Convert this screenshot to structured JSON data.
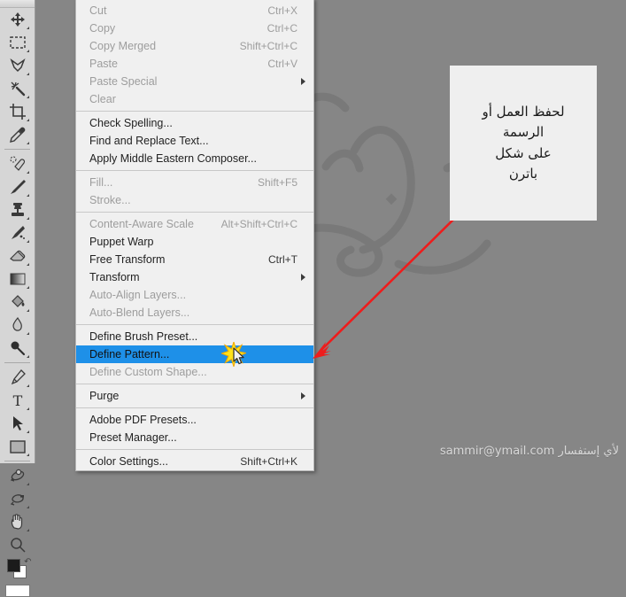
{
  "app": {
    "name": "Adobe Photoshop",
    "background_color": "#868686",
    "accent_color": "#1e90e8",
    "arrow_color": "#ee1c1c"
  },
  "toolbar": {
    "name": "tools-panel",
    "tools": [
      {
        "id": "move-tool",
        "label": "Move Tool"
      },
      {
        "id": "rectangular-marquee-tool",
        "label": "Rectangular Marquee Tool"
      },
      {
        "id": "lasso-tool",
        "label": "Lasso Tool"
      },
      {
        "id": "quick-selection-tool",
        "label": "Quick Selection Tool"
      },
      {
        "id": "crop-tool",
        "label": "Crop Tool"
      },
      {
        "id": "eyedropper-tool",
        "label": "Eyedropper Tool"
      },
      {
        "id": "spot-healing-brush-tool",
        "label": "Spot Healing Brush Tool"
      },
      {
        "id": "brush-tool",
        "label": "Brush Tool"
      },
      {
        "id": "clone-stamp-tool",
        "label": "Clone Stamp Tool"
      },
      {
        "id": "history-brush-tool",
        "label": "History Brush Tool"
      },
      {
        "id": "eraser-tool",
        "label": "Eraser Tool"
      },
      {
        "id": "gradient-tool",
        "label": "Gradient Tool"
      },
      {
        "id": "blur-tool",
        "label": "Blur Tool"
      },
      {
        "id": "dodge-tool",
        "label": "Dodge Tool"
      },
      {
        "id": "pen-tool",
        "label": "Pen Tool"
      },
      {
        "id": "horizontal-type-tool",
        "label": "Horizontal Type Tool"
      },
      {
        "id": "path-selection-tool",
        "label": "Path Selection Tool"
      },
      {
        "id": "rectangle-tool",
        "label": "Rectangle Tool"
      },
      {
        "id": "rotate-view-tool",
        "label": "3D Rotate Tool"
      },
      {
        "id": "orbit-tool",
        "label": "3D Orbit Tool"
      },
      {
        "id": "hand-tool",
        "label": "Hand Tool"
      },
      {
        "id": "zoom-tool",
        "label": "Zoom Tool"
      }
    ],
    "color_swatches": {
      "foreground": "#1b1b1b",
      "background": "#ffffff",
      "swap_label": "Switch Foreground and Background Colors"
    }
  },
  "menu": {
    "name": "edit-menu",
    "items": [
      {
        "label": "Cut",
        "shortcut": "Ctrl+X",
        "disabled": true,
        "submenu": false,
        "selected": false
      },
      {
        "label": "Copy",
        "shortcut": "Ctrl+C",
        "disabled": true,
        "submenu": false,
        "selected": false
      },
      {
        "label": "Copy Merged",
        "shortcut": "Shift+Ctrl+C",
        "disabled": true,
        "submenu": false,
        "selected": false
      },
      {
        "label": "Paste",
        "shortcut": "Ctrl+V",
        "disabled": true,
        "submenu": false,
        "selected": false
      },
      {
        "label": "Paste Special",
        "shortcut": "",
        "disabled": true,
        "submenu": true,
        "selected": false
      },
      {
        "label": "Clear",
        "shortcut": "",
        "disabled": true,
        "submenu": false,
        "selected": false
      },
      {
        "separator": true
      },
      {
        "label": "Check Spelling...",
        "shortcut": "",
        "disabled": false,
        "submenu": false,
        "selected": false
      },
      {
        "label": "Find and Replace Text...",
        "shortcut": "",
        "disabled": false,
        "submenu": false,
        "selected": false
      },
      {
        "label": "Apply Middle Eastern Composer...",
        "shortcut": "",
        "disabled": false,
        "submenu": false,
        "selected": false
      },
      {
        "separator": true
      },
      {
        "label": "Fill...",
        "shortcut": "Shift+F5",
        "disabled": true,
        "submenu": false,
        "selected": false
      },
      {
        "label": "Stroke...",
        "shortcut": "",
        "disabled": true,
        "submenu": false,
        "selected": false
      },
      {
        "separator": true
      },
      {
        "label": "Content-Aware Scale",
        "shortcut": "Alt+Shift+Ctrl+C",
        "disabled": true,
        "submenu": false,
        "selected": false
      },
      {
        "label": "Puppet Warp",
        "shortcut": "",
        "disabled": false,
        "submenu": false,
        "selected": false
      },
      {
        "label": "Free Transform",
        "shortcut": "Ctrl+T",
        "disabled": false,
        "submenu": false,
        "selected": false
      },
      {
        "label": "Transform",
        "shortcut": "",
        "disabled": false,
        "submenu": true,
        "selected": false
      },
      {
        "label": "Auto-Align Layers...",
        "shortcut": "",
        "disabled": true,
        "submenu": false,
        "selected": false
      },
      {
        "label": "Auto-Blend Layers...",
        "shortcut": "",
        "disabled": true,
        "submenu": false,
        "selected": false
      },
      {
        "separator": true
      },
      {
        "label": "Define Brush Preset...",
        "shortcut": "",
        "disabled": false,
        "submenu": false,
        "selected": false
      },
      {
        "label": "Define Pattern...",
        "shortcut": "",
        "disabled": false,
        "submenu": false,
        "selected": true
      },
      {
        "label": "Define Custom Shape...",
        "shortcut": "",
        "disabled": true,
        "submenu": false,
        "selected": false
      },
      {
        "separator": true
      },
      {
        "label": "Purge",
        "shortcut": "",
        "disabled": false,
        "submenu": true,
        "selected": false
      },
      {
        "separator": true
      },
      {
        "label": "Adobe PDF Presets...",
        "shortcut": "",
        "disabled": false,
        "submenu": false,
        "selected": false
      },
      {
        "label": "Preset Manager...",
        "shortcut": "",
        "disabled": false,
        "submenu": false,
        "selected": false
      },
      {
        "separator": true
      },
      {
        "label": "Color Settings...",
        "shortcut": "Shift+Ctrl+K",
        "disabled": false,
        "submenu": false,
        "selected": false
      }
    ]
  },
  "note": {
    "name": "annotation-note",
    "lines": [
      "لحفظ العمل أو",
      "الرسمة",
      "على شكل",
      "باترن"
    ]
  },
  "credit": {
    "text_ar": "لأي إستفسار",
    "email": "sammir@ymail.com"
  },
  "watermark": {
    "description": "Arabic calligraphy watermark"
  }
}
